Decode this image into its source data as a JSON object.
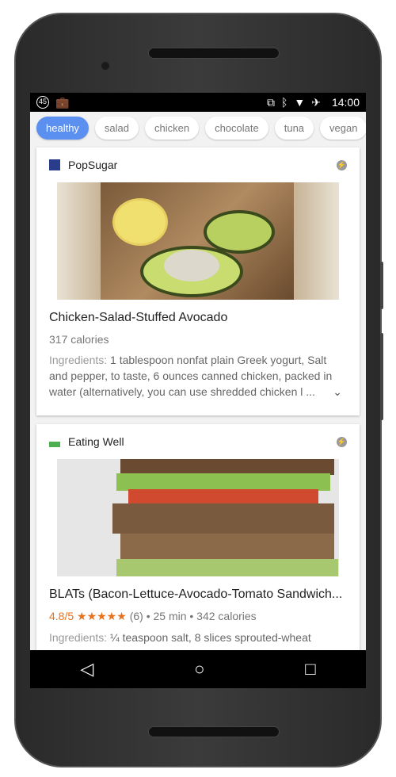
{
  "status": {
    "notif_badge": "45",
    "time": "14:00"
  },
  "chips": [
    {
      "label": "healthy",
      "active": true
    },
    {
      "label": "salad"
    },
    {
      "label": "chicken"
    },
    {
      "label": "chocolate"
    },
    {
      "label": "tuna"
    },
    {
      "label": "vegan"
    }
  ],
  "cards": [
    {
      "source": "PopSugar",
      "title": "Chicken-Salad-Stuffed Avocado",
      "meta": "317 calories",
      "ingredients_label": "Ingredients:",
      "ingredients": " 1 tablespoon nonfat plain Greek yogurt, Salt and pepper, to taste, 6 ounces canned chicken, packed in water (alternatively, you can use shredded chicken l ..."
    },
    {
      "source": "Eating Well",
      "title": "BLATs (Bacon-Lettuce-Avocado-Tomato Sandwich...",
      "rating": "4.8/5",
      "stars": "★★★★★",
      "meta": "(6) • 25 min • 342 calories",
      "ingredients_label": "Ingredients:",
      "ingredients": " ¼ teaspoon salt, 8 slices sprouted-wheat"
    }
  ],
  "colors": {
    "accent": "#5b8ff0",
    "rating": "#e8711c"
  }
}
